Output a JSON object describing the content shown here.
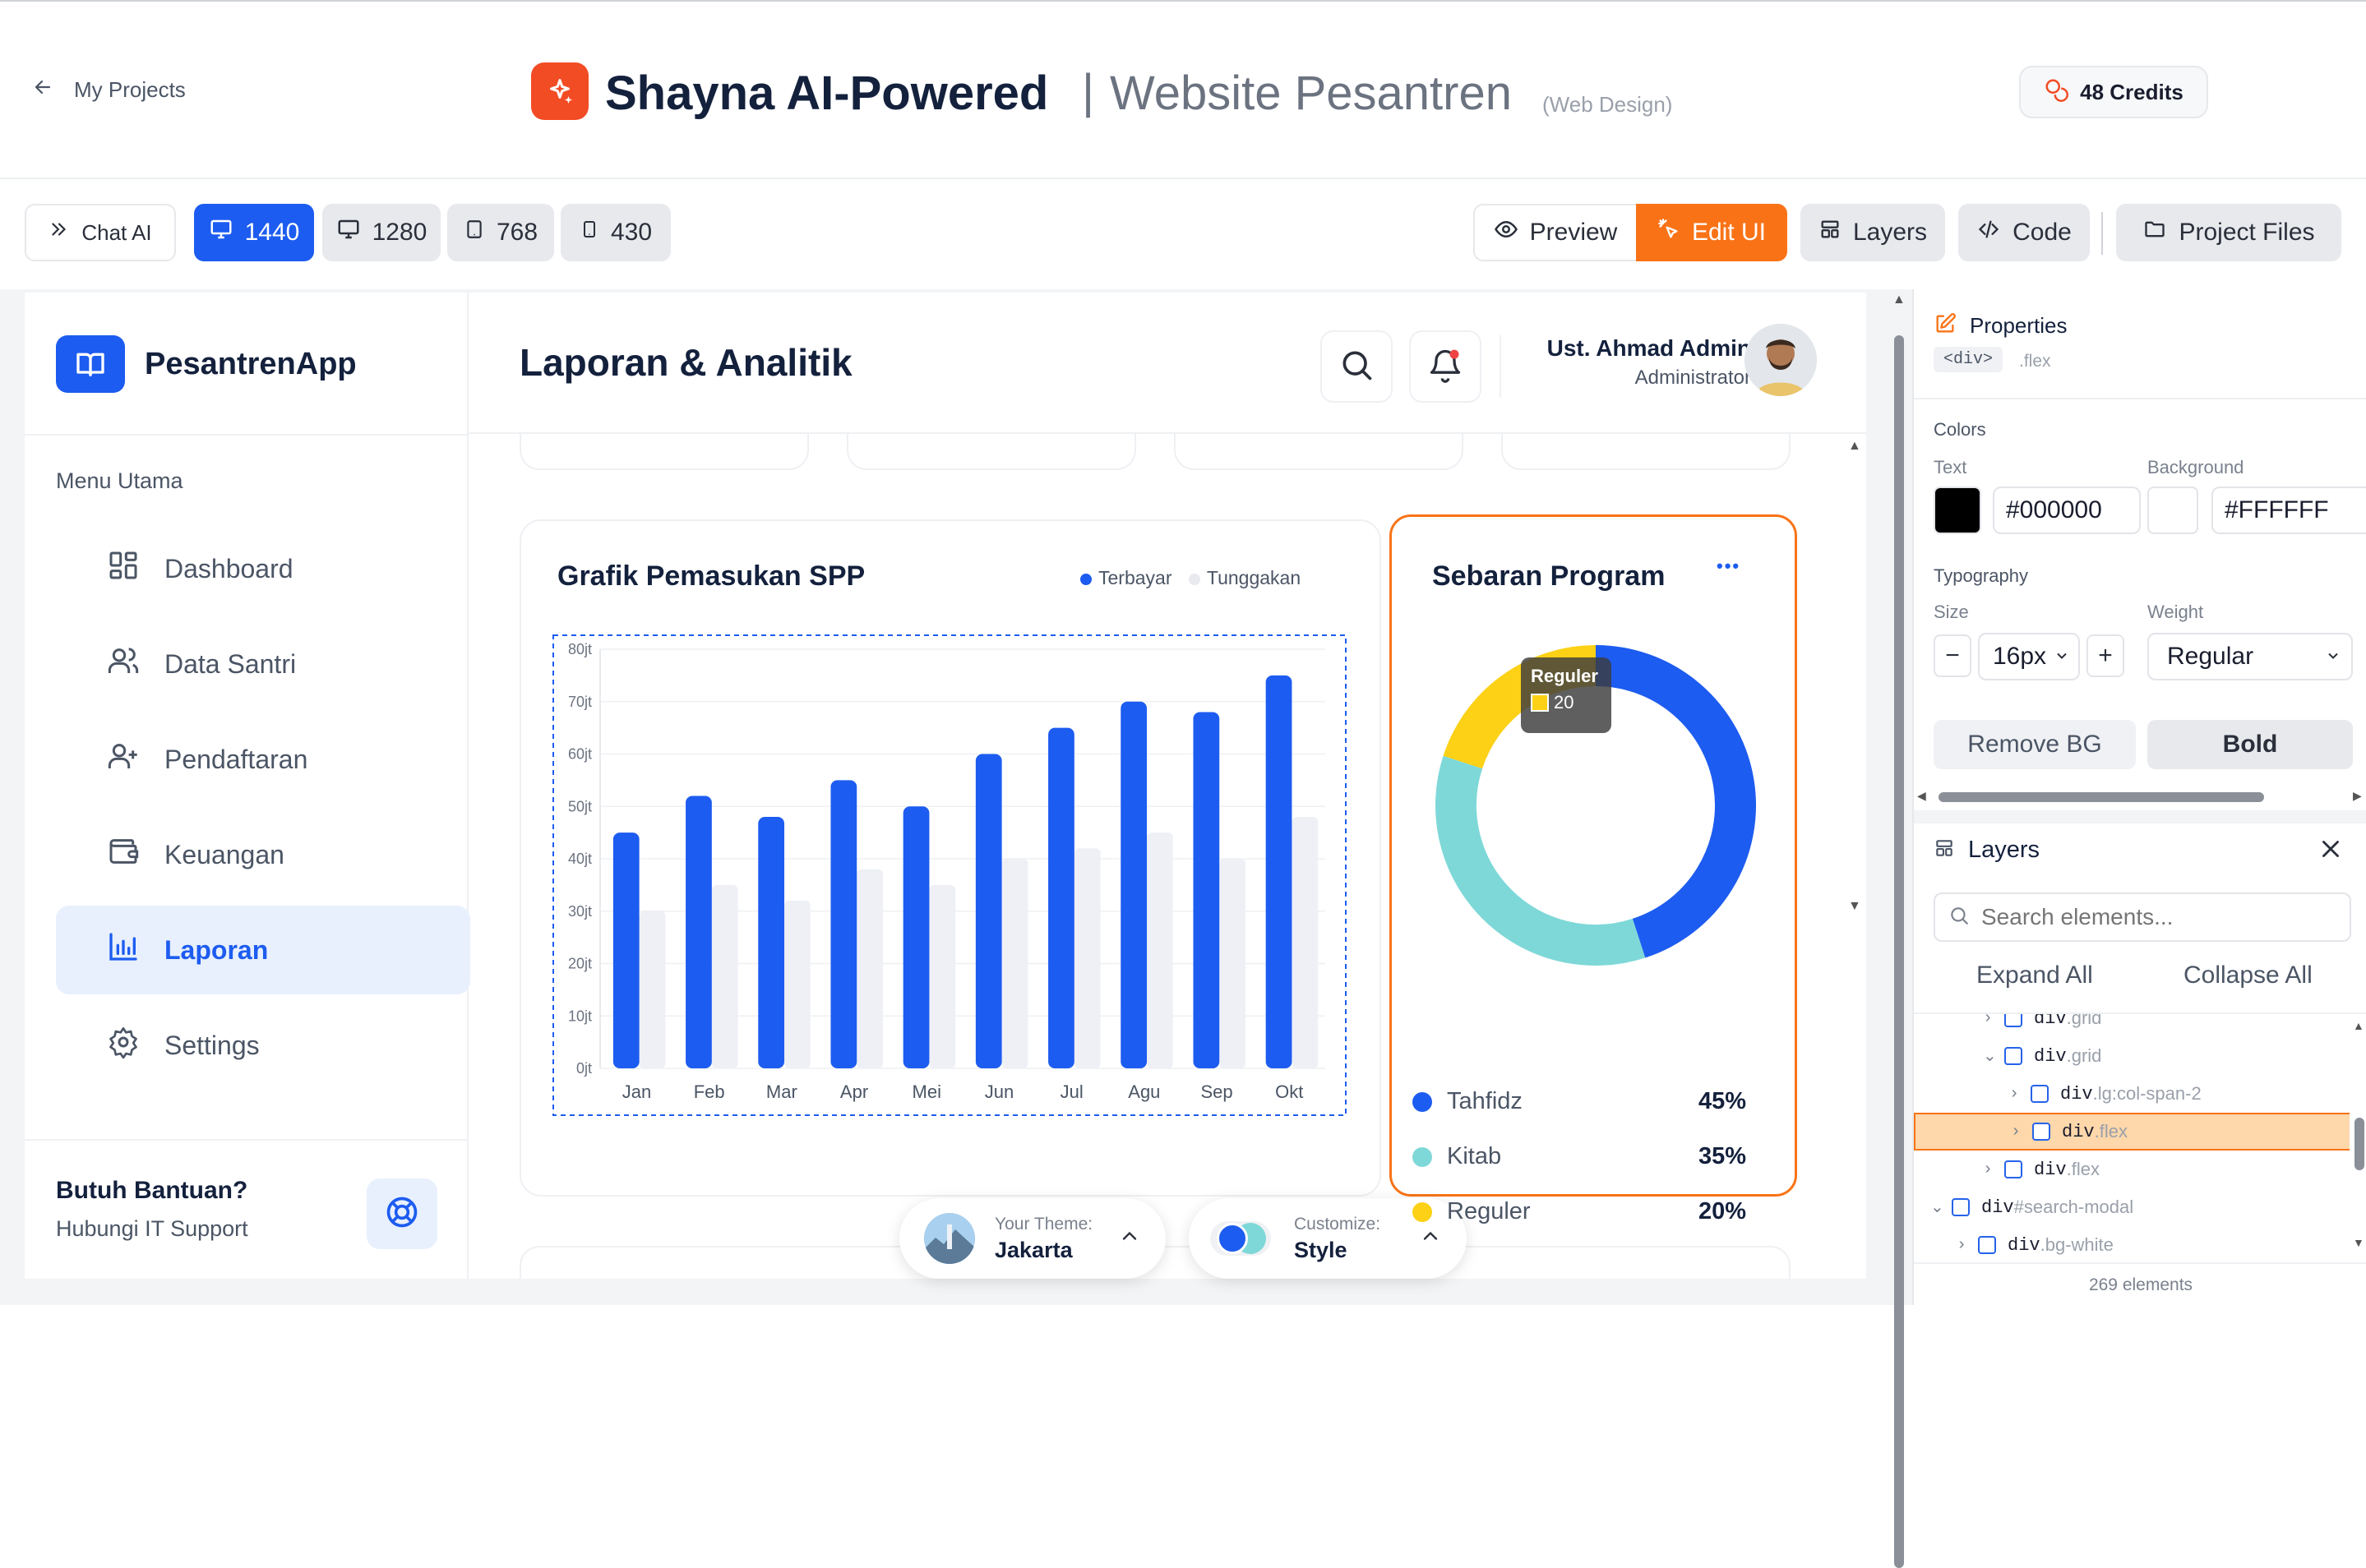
{
  "header": {
    "back_label": "My Projects",
    "title_main": "Shayna AI-Powered",
    "title_separator": "|",
    "title_project": "Website Pesantren",
    "title_type": "(Web Design)",
    "credits": "48 Credits"
  },
  "toolbar": {
    "chat_ai": "Chat AI",
    "sizes": [
      "1440",
      "1280",
      "768",
      "430"
    ],
    "active_size": "1440",
    "preview": "Preview",
    "edit_ui": "Edit UI",
    "layers": "Layers",
    "code": "Code",
    "project_files": "Project Files"
  },
  "app": {
    "brand": "PesantrenApp",
    "menu_heading": "Menu Utama",
    "menu": [
      {
        "label": "Dashboard",
        "icon": "grid-icon"
      },
      {
        "label": "Data Santri",
        "icon": "users-icon"
      },
      {
        "label": "Pendaftaran",
        "icon": "user-plus-icon"
      },
      {
        "label": "Keuangan",
        "icon": "wallet-icon"
      },
      {
        "label": "Laporan",
        "icon": "bar-chart-icon",
        "active": true
      },
      {
        "label": "Settings",
        "icon": "gear-icon"
      }
    ],
    "help_title": "Butuh Bantuan?",
    "help_sub": "Hubungi IT Support",
    "page_title": "Laporan & Analitik",
    "user_name": "Ust. Ahmad Admin",
    "user_role": "Administrator"
  },
  "spp_card": {
    "title": "Grafik Pemasukan SPP",
    "legend_paid": "Terbayar",
    "legend_due": "Tunggakan"
  },
  "chart_data": [
    {
      "type": "bar",
      "title": "Grafik Pemasukan SPP",
      "categories": [
        "Jan",
        "Feb",
        "Mar",
        "Apr",
        "Mei",
        "Jun",
        "Jul",
        "Agu",
        "Sep",
        "Okt"
      ],
      "series": [
        {
          "name": "Terbayar",
          "values": [
            45,
            52,
            48,
            55,
            50,
            60,
            65,
            70,
            68,
            75
          ]
        },
        {
          "name": "Tunggakan",
          "values": [
            30,
            35,
            32,
            38,
            35,
            40,
            42,
            45,
            40,
            48
          ]
        }
      ],
      "y_ticks": [
        "0jt",
        "10jt",
        "20jt",
        "30jt",
        "40jt",
        "50jt",
        "60jt",
        "70jt",
        "80jt"
      ],
      "ylim": [
        0,
        80
      ],
      "legend": "top-right",
      "grid": true,
      "colors": {
        "Terbayar": "#1d5cf0",
        "Tunggakan": "#eef0f6"
      }
    },
    {
      "type": "pie",
      "title": "Sebaran Program",
      "categories": [
        "Tahfidz",
        "Kitab",
        "Reguler"
      ],
      "values": [
        45,
        35,
        20
      ],
      "labels": [
        "45%",
        "35%",
        "20%"
      ],
      "colors": [
        "#1d5cf0",
        "#7fd8d8",
        "#fcd116"
      ],
      "tooltip": {
        "label": "Reguler",
        "value": "20"
      }
    }
  ],
  "program_card": {
    "title": "Sebaran Program",
    "more": "•••"
  },
  "theme": {
    "theme_label": "Your Theme:",
    "theme_value": "Jakarta",
    "customize_label": "Customize:",
    "customize_value": "Style"
  },
  "properties": {
    "title": "Properties",
    "tag": "<div>",
    "class": ".flex",
    "colors_heading": "Colors",
    "text_label": "Text",
    "bg_label": "Background",
    "text_color": "#000000",
    "bg_color": "#FFFFFF",
    "typography_heading": "Typography",
    "size_label": "Size",
    "weight_label": "Weight",
    "size_value": "16px",
    "weight_value": "Regular",
    "remove_bg": "Remove BG",
    "bold": "Bold"
  },
  "layers_panel": {
    "title": "Layers",
    "search_placeholder": "Search elements...",
    "expand_all": "Expand All",
    "collapse_all": "Collapse All",
    "items": [
      {
        "tag": "div",
        "cls": ".grid",
        "indent": 2,
        "chev": "›"
      },
      {
        "tag": "div",
        "cls": ".grid",
        "indent": 2,
        "chev": "⌄"
      },
      {
        "tag": "div",
        "cls": ".lg:col-span-2",
        "indent": 3,
        "chev": "›"
      },
      {
        "tag": "div",
        "cls": ".flex",
        "indent": 3,
        "chev": "›",
        "selected": true
      },
      {
        "tag": "div",
        "cls": ".flex",
        "indent": 2,
        "chev": "›"
      },
      {
        "tag": "div",
        "cls": "#search-modal",
        "indent": 0,
        "chev": "⌄"
      },
      {
        "tag": "div",
        "cls": ".bg-white",
        "indent": 1,
        "chev": "›"
      }
    ],
    "count": "269 elements"
  }
}
